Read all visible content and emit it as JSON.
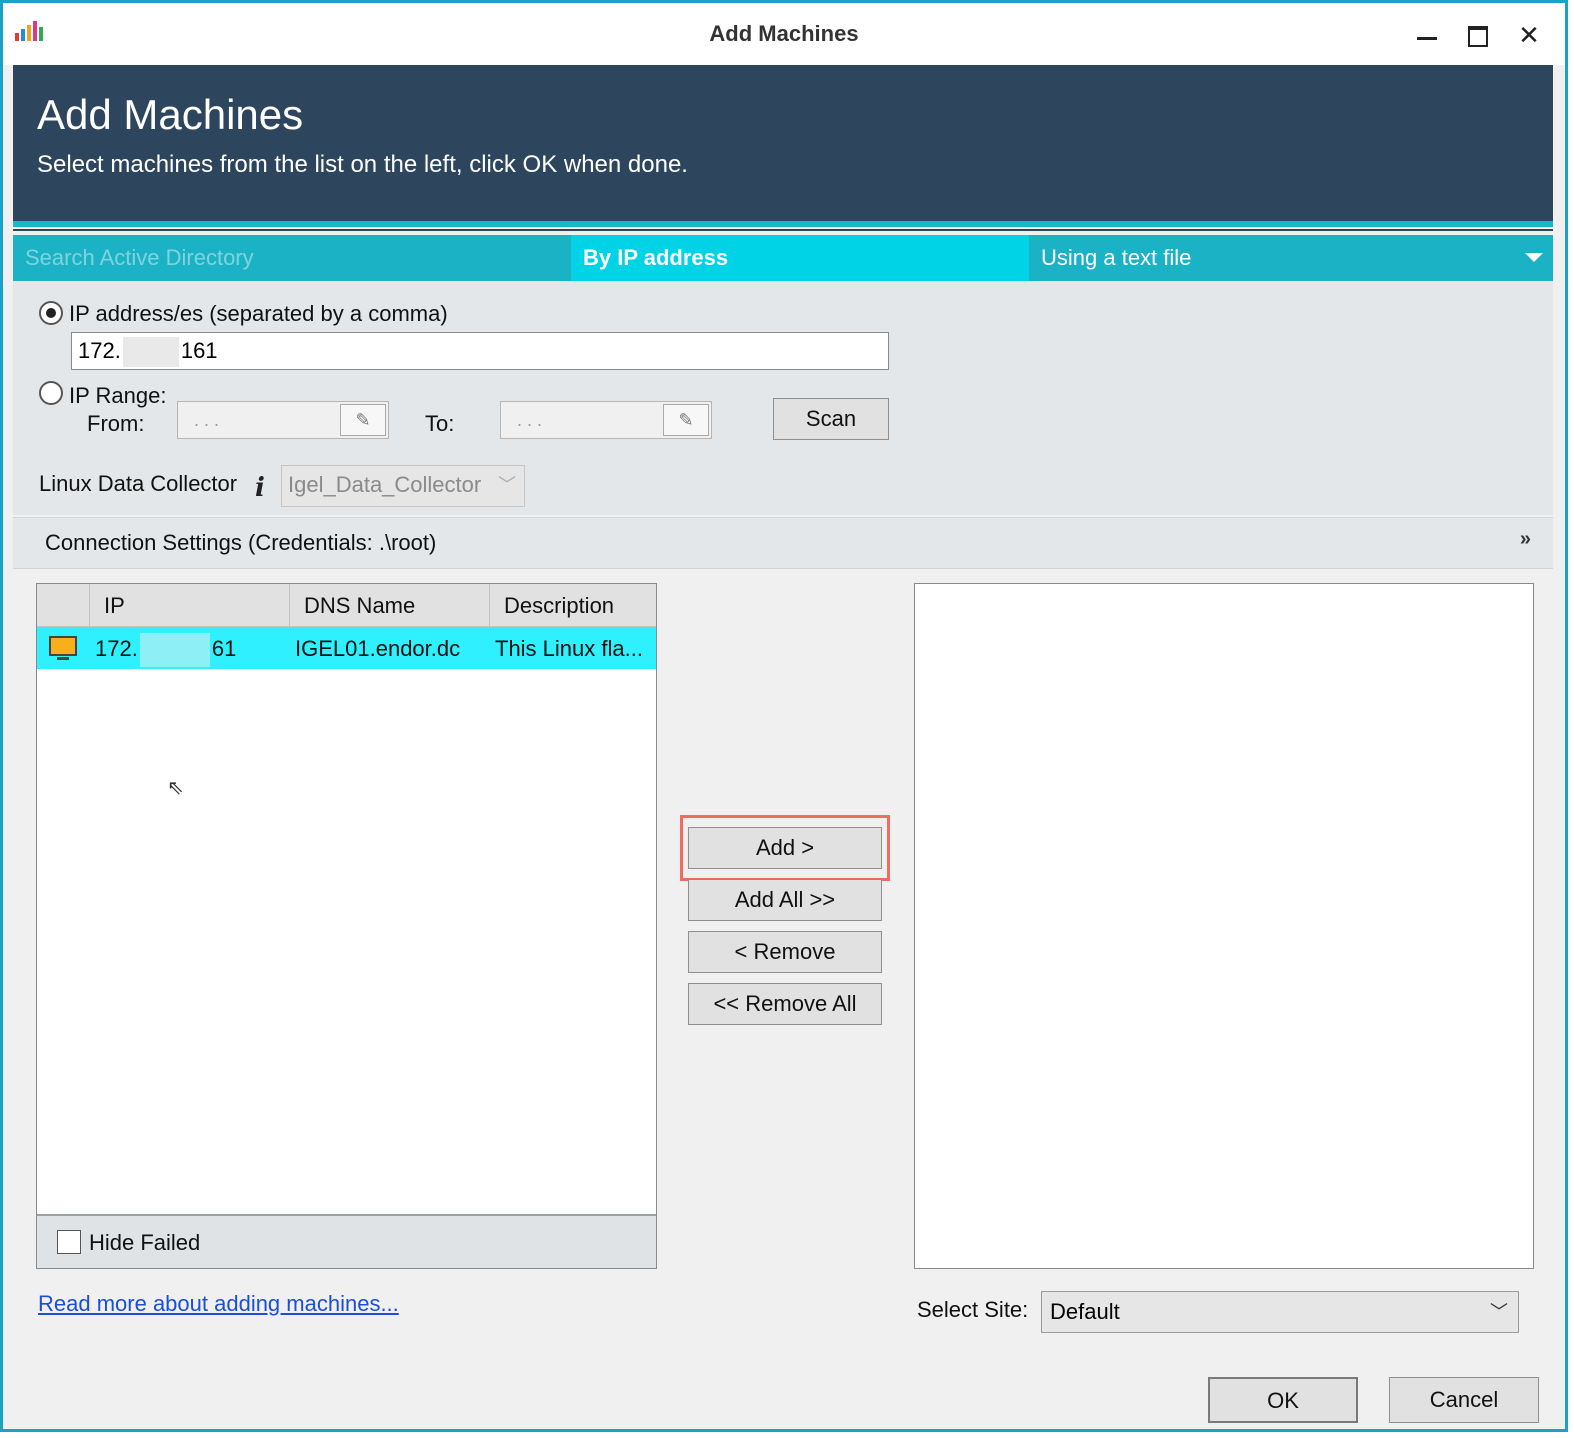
{
  "window": {
    "title": "Add Machines"
  },
  "banner": {
    "title": "Add Machines",
    "subtitle": "Select machines from the list on the left, click OK when done."
  },
  "tabs": [
    {
      "label": "Search Active Directory",
      "active": false
    },
    {
      "label": "By IP address",
      "active": true
    },
    {
      "label": "Using a text file",
      "active": false
    }
  ],
  "ip_options": {
    "addresses_label": "IP address/es (separated by a comma)",
    "addresses_value_prefix": "172.",
    "addresses_value_suffix": "161",
    "range_label": "IP Range:",
    "from_label": "From:",
    "to_label": "To:",
    "from_value": ". . .",
    "to_value": ". . .",
    "scan_label": "Scan",
    "collector_label": "Linux Data Collector",
    "collector_value": "Igel_Data_Collector"
  },
  "connection": {
    "label": "Connection Settings (Credentials: .\\root)"
  },
  "grid": {
    "columns": [
      "IP",
      "DNS Name",
      "Description"
    ],
    "rows": [
      {
        "ip_prefix": "172.",
        "ip_suffix": "61",
        "dns": "IGEL01.endor.dc",
        "description": "This Linux fla..."
      }
    ],
    "hide_failed_label": "Hide Failed"
  },
  "actions": {
    "add": "Add >",
    "add_all": "Add All >>",
    "remove": "< Remove",
    "remove_all": "<< Remove All"
  },
  "footer": {
    "read_more": "Read more about adding machines...",
    "select_site_label": "Select Site:",
    "select_site_value": "Default",
    "ok": "OK",
    "cancel": "Cancel"
  },
  "colors": {
    "header": "#2d465d",
    "tab_bar": "#1cb2c6",
    "tab_active": "#00d3e6",
    "row_selected": "#2ff0ff",
    "highlight": "#f06c62"
  }
}
